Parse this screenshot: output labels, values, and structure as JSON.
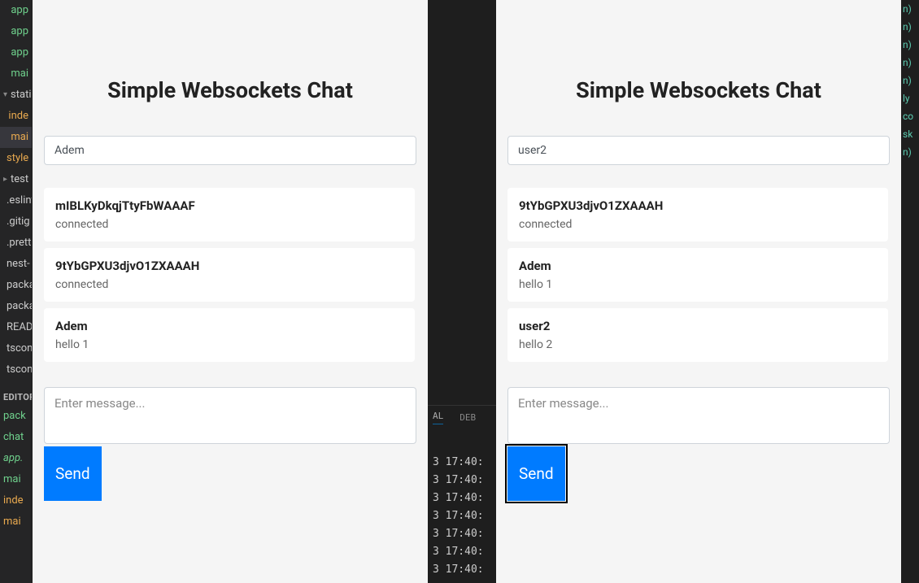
{
  "vscode_tree": {
    "items_top": [
      {
        "label": "app",
        "cls": "ts-green",
        "chev": ""
      },
      {
        "label": "app",
        "cls": "ts-green",
        "chev": ""
      },
      {
        "label": "app",
        "cls": "ts-green",
        "chev": ""
      },
      {
        "label": "mai",
        "cls": "ts-green",
        "chev": ""
      },
      {
        "label": "static",
        "cls": "plain",
        "chev": "▾"
      },
      {
        "label": "inde",
        "cls": "ts-orange",
        "chev": ""
      },
      {
        "label": "mai",
        "cls": "ts-orange",
        "chev": "",
        "active": true
      },
      {
        "label": "style",
        "cls": "ts-orange",
        "chev": ""
      },
      {
        "label": "test",
        "cls": "plain",
        "chev": "▸"
      },
      {
        "label": ".eslint",
        "cls": "plain",
        "chev": ""
      },
      {
        "label": ".gitig",
        "cls": "plain",
        "chev": ""
      },
      {
        "label": ".prett",
        "cls": "plain",
        "chev": ""
      },
      {
        "label": "nest-",
        "cls": "plain",
        "chev": ""
      },
      {
        "label": "packa",
        "cls": "plain",
        "chev": ""
      },
      {
        "label": "packa",
        "cls": "plain",
        "chev": ""
      },
      {
        "label": "READ",
        "cls": "plain",
        "chev": ""
      },
      {
        "label": "tscon",
        "cls": "plain",
        "chev": ""
      },
      {
        "label": "tscon",
        "cls": "plain",
        "chev": ""
      }
    ],
    "editors_title": "EDITOR",
    "items_editors": [
      {
        "label": "pack",
        "cls": "ts-green"
      },
      {
        "label": "chat",
        "cls": "ts-green"
      },
      {
        "label": "app.",
        "cls": "ts-green italic"
      },
      {
        "label": "mai",
        "cls": "ts-green"
      },
      {
        "label": "inde",
        "cls": "ts-orange"
      },
      {
        "label": "mai",
        "cls": "ts-orange"
      }
    ]
  },
  "vscode_right_fragments": [
    "n)",
    "n)",
    "n)",
    "n)",
    "n)",
    "",
    "",
    "",
    "",
    "",
    "",
    "",
    "",
    "",
    "",
    "",
    "",
    "",
    "",
    "",
    "",
    "",
    "",
    "",
    "",
    "",
    "",
    "",
    "",
    "ly",
    "co",
    "sk",
    "n)"
  ],
  "center": {
    "tab_al": "AL",
    "tab_debug": "DEB",
    "terminal_lines": [
      "3 17:40:",
      "3 17:40:",
      "3 17:40:",
      "3 17:40:",
      "3 17:40:",
      "3 17:40:",
      "3 17:40:"
    ]
  },
  "chat1": {
    "title": "Simple Websockets Chat",
    "name_value": "Adem",
    "messages": [
      {
        "author": "mIBLKyDkqjTtyFbWAAAF",
        "body": "connected"
      },
      {
        "author": "9tYbGPXU3djvO1ZXAAAH",
        "body": "connected"
      },
      {
        "author": "Adem",
        "body": "hello 1"
      }
    ],
    "compose_placeholder": "Enter message...",
    "send_label": "Send",
    "send_focused": false
  },
  "chat2": {
    "title": "Simple Websockets Chat",
    "name_value": "user2",
    "messages": [
      {
        "author": "9tYbGPXU3djvO1ZXAAAH",
        "body": "connected"
      },
      {
        "author": "Adem",
        "body": "hello 1"
      },
      {
        "author": "user2",
        "body": "hello 2"
      }
    ],
    "compose_placeholder": "Enter message...",
    "send_label": "Send",
    "send_focused": true
  }
}
